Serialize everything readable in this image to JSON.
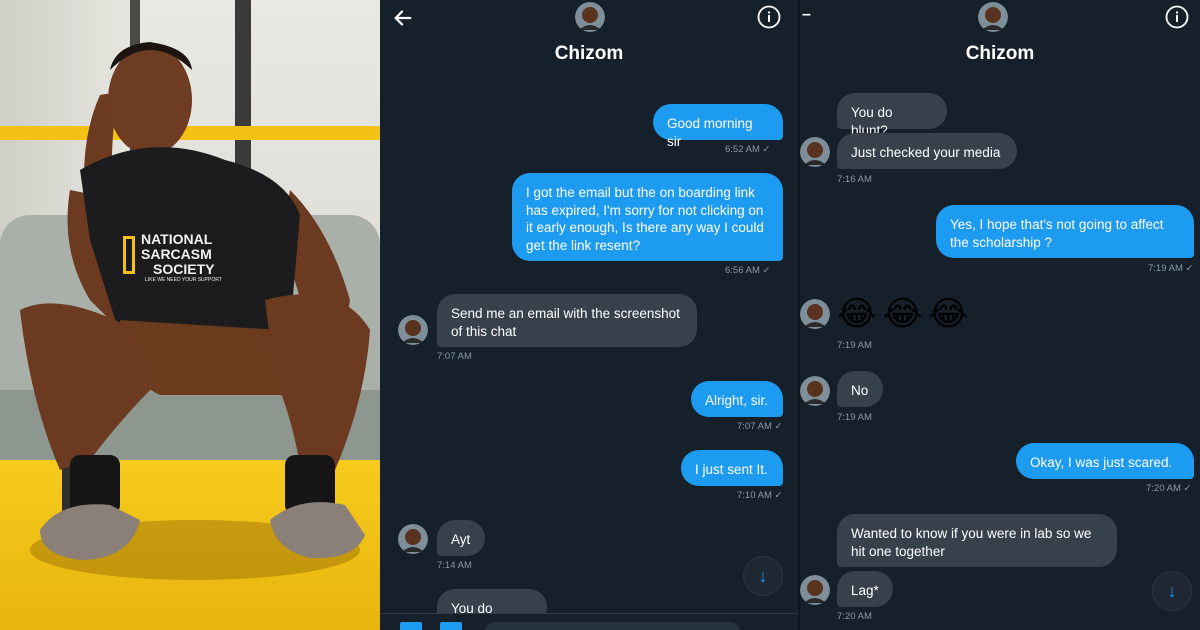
{
  "colors": {
    "background": "#15202b",
    "outgoing_bubble": "#1d9bf0",
    "incoming_bubble": "#37414c",
    "timestamp": "#8b98a5",
    "accent": "#1d9bf0"
  },
  "photo": {
    "shirt_text_line1": "NATIONAL",
    "shirt_text_line2": "SARCASM",
    "shirt_text_line3": "SOCIETY",
    "shirt_text_line4": "LIKE WE NEED YOUR SUPPORT"
  },
  "panel1": {
    "header": {
      "title": "Chizom",
      "back_icon": "arrow-left-icon",
      "info_icon": "info-circle-icon"
    },
    "messages": [
      {
        "dir": "out",
        "text": "Good morning sir",
        "time": "6:52 AM ✓"
      },
      {
        "dir": "out",
        "text": "I got the email but the on boarding link has expired, I'm sorry for not clicking on it early enough, Is there any way I could get the link resent?",
        "time": "6:56 AM ✓"
      },
      {
        "dir": "in",
        "text": "Send me an email with the screenshot of this chat",
        "time": "7:07 AM"
      },
      {
        "dir": "out",
        "text": "Alright, sir.",
        "time": "7:07 AM ✓"
      },
      {
        "dir": "out",
        "text": "I just sent It.",
        "time": "7:10 AM ✓"
      },
      {
        "dir": "in",
        "text": "Ayt",
        "time": "7:14 AM"
      },
      {
        "dir": "in",
        "text": "You do blunt?",
        "time": ""
      }
    ],
    "scroll_icon": "arrow-down-icon"
  },
  "panel2": {
    "header": {
      "title": "Chizom",
      "back_icon": "dash-icon",
      "info_icon": "info-circle-icon"
    },
    "messages": [
      {
        "dir": "in",
        "text": "You do blunt?",
        "time": ""
      },
      {
        "dir": "in",
        "text": "Just checked your media",
        "time": "7:16 AM"
      },
      {
        "dir": "out",
        "text": "Yes, I hope that's not going to affect the scholarship ?",
        "time": "7:19 AM ✓"
      },
      {
        "dir": "in",
        "text": "😂😂😂",
        "time": "7:19 AM"
      },
      {
        "dir": "in",
        "text": "No",
        "time": "7:19 AM"
      },
      {
        "dir": "out",
        "text": "Okay, I was just scared.",
        "time": "7:20 AM ✓"
      },
      {
        "dir": "in",
        "text": "Wanted to know if you were in lab so we hit one together",
        "time": ""
      },
      {
        "dir": "in",
        "text": "Lag*",
        "time": "7:20 AM"
      }
    ],
    "scroll_icon": "arrow-down-icon"
  }
}
